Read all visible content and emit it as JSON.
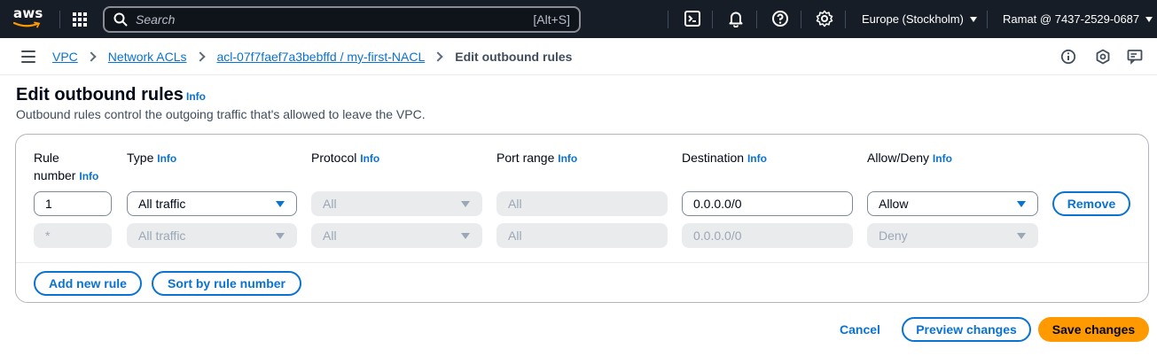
{
  "topnav": {
    "logo_text": "aws",
    "search_placeholder": "Search",
    "search_shortcut": "[Alt+S]",
    "icons": [
      "cloudshell-icon",
      "bell-icon",
      "help-icon",
      "settings-icon"
    ],
    "region": "Europe (Stockholm)",
    "account": "Ramat @ 7437-2529-0687"
  },
  "breadcrumb": {
    "items": [
      "VPC",
      "Network ACLs",
      "acl-07f7faef7a3bebffd / my-first-NACL"
    ],
    "current": "Edit outbound rules"
  },
  "page": {
    "title": "Edit outbound rules",
    "title_info": "Info",
    "description": "Outbound rules control the outgoing traffic that's allowed to leave the VPC."
  },
  "columns": {
    "rule_number_line1": "Rule",
    "rule_number_line2": "number",
    "type": "Type",
    "protocol": "Protocol",
    "port_range": "Port range",
    "destination": "Destination",
    "allow_deny": "Allow/Deny",
    "info": "Info"
  },
  "rules": [
    {
      "rule_number": "1",
      "type": "All traffic",
      "protocol": "All",
      "port_range": "All",
      "destination": "0.0.0.0/0",
      "allow_deny": "Allow",
      "remove_label": "Remove"
    },
    {
      "rule_number": "*",
      "type": "All traffic",
      "protocol": "All",
      "port_range": "All",
      "destination": "0.0.0.0/0",
      "allow_deny": "Deny"
    }
  ],
  "actions": {
    "add_rule": "Add new rule",
    "sort_rules": "Sort by rule number",
    "cancel": "Cancel",
    "preview": "Preview changes",
    "save": "Save changes"
  },
  "colors": {
    "nav_bg": "#161d26",
    "link": "#0972d3",
    "primary_button": "#ff9900"
  }
}
